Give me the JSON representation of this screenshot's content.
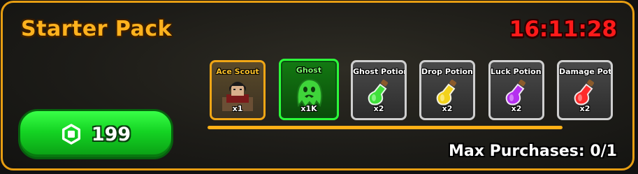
{
  "title": "Starter Pack",
  "timer": "16:11:28",
  "buy_button": {
    "currency_icon": "robux-icon",
    "price": "199"
  },
  "items": [
    {
      "name": "Ace Scout",
      "qty": "x1",
      "icon": "ace-scout-character",
      "style": "gold"
    },
    {
      "name": "Ghost",
      "qty": "x1K",
      "icon": "ghost-icon",
      "style": "green"
    },
    {
      "name": "Ghost Potion I",
      "qty": "x2",
      "icon": "potion-icon",
      "style": "gray",
      "color": "#3fe03a"
    },
    {
      "name": "Drop Potion I",
      "qty": "x2",
      "icon": "potion-icon",
      "style": "gray",
      "color": "#f2d21a"
    },
    {
      "name": "Luck Potion I",
      "qty": "x2",
      "icon": "potion-icon",
      "style": "gray",
      "color": "#b530f0"
    },
    {
      "name": "Damage Potion I",
      "qty": "x2",
      "icon": "potion-icon",
      "style": "gray",
      "color": "#ff2b2b"
    }
  ],
  "progress": 1.0,
  "max_purchases": "Max Purchases: 0/1",
  "colors": {
    "accent": "#e69d12",
    "timer": "#ff1a1a",
    "buy": "#14d323"
  }
}
